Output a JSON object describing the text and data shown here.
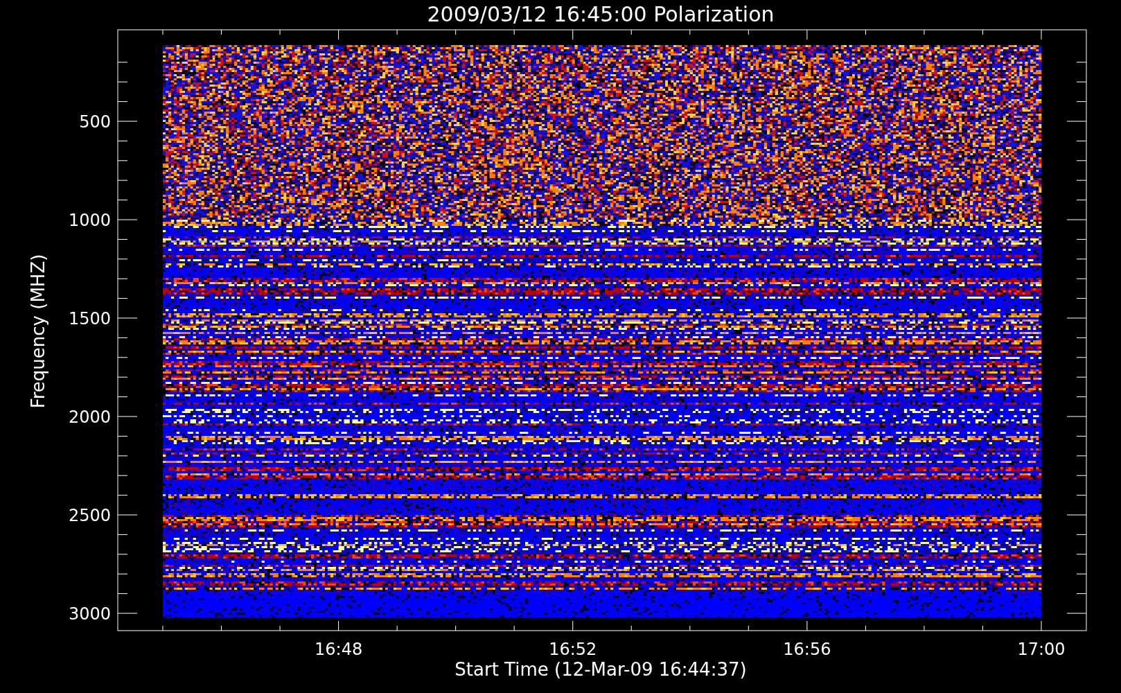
{
  "title": "2009/03/12 16:45:00 Polarization",
  "y_axis": {
    "label": "Frequency (MHZ)",
    "ticks": [
      "500",
      "1000",
      "1500",
      "2000",
      "2500",
      "3000"
    ]
  },
  "x_axis": {
    "label": "Start Time (12-Mar-09 16:44:37)",
    "ticks": [
      "16:48",
      "16:52",
      "16:56",
      "17:00"
    ]
  }
}
